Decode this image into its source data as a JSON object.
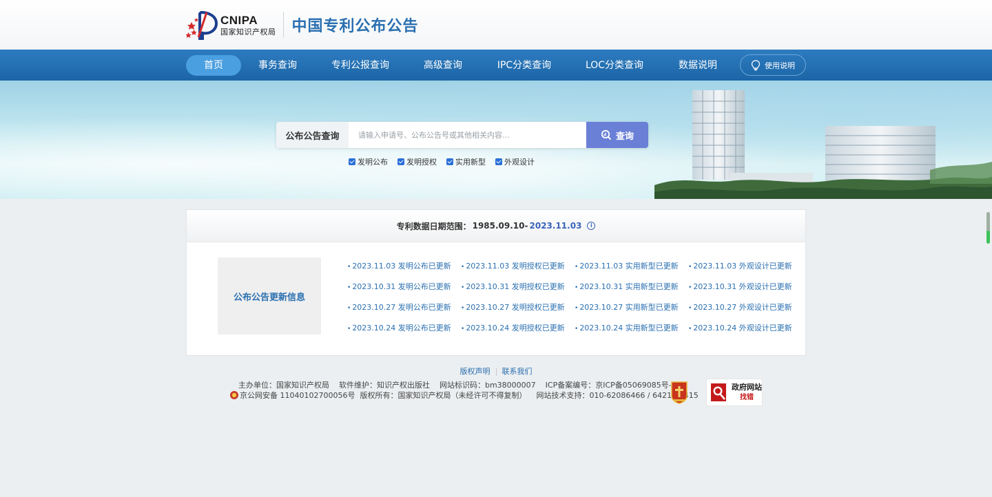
{
  "header": {
    "logo_en": "CNIPA",
    "logo_cn": "国家知识产权局",
    "site_title": "中国专利公布公告"
  },
  "nav": {
    "items": [
      {
        "label": "首页",
        "active": true
      },
      {
        "label": "事务查询"
      },
      {
        "label": "专利公报查询"
      },
      {
        "label": "高级查询"
      },
      {
        "label": "IPC分类查询"
      },
      {
        "label": "LOC分类查询"
      },
      {
        "label": "数据说明"
      }
    ],
    "help_label": "使用说明"
  },
  "search": {
    "label": "公布公告查询",
    "placeholder": "请输入申请号、公布公告号或其他相关内容...",
    "button_label": "查询",
    "filters": [
      "发明公布",
      "发明授权",
      "实用新型",
      "外观设计"
    ]
  },
  "panel": {
    "range_label": "专利数据日期范围：",
    "range_start": "1985.09.10-",
    "range_end": "2023.11.03",
    "info_icon": "info-icon",
    "update_title": "公布公告更新信息",
    "updates": [
      "2023.11.03 发明公布已更新",
      "2023.11.03 发明授权已更新",
      "2023.11.03 实用新型已更新",
      "2023.11.03 外观设计已更新",
      "2023.10.31 发明公布已更新",
      "2023.10.31 发明授权已更新",
      "2023.10.31 实用新型已更新",
      "2023.10.31 外观设计已更新",
      "2023.10.27 发明公布已更新",
      "2023.10.27 发明授权已更新",
      "2023.10.27 实用新型已更新",
      "2023.10.27 外观设计已更新",
      "2023.10.24 发明公布已更新",
      "2023.10.24 发明授权已更新",
      "2023.10.24 实用新型已更新",
      "2023.10.24 外观设计已更新"
    ]
  },
  "footer": {
    "copyright_link": "版权声明",
    "contact_link": "联系我们",
    "line1": "主办单位：国家知识产权局    软件维护：知识产权出版社    网站标识码：bm38000007    ICP备案编号：京ICP备05069085号-14",
    "line2_police": "京公网安备 11040102700056号",
    "line2_rest": "  版权所有：国家知识产权局（未经许可不得复制）    网站技术支持：010-62086466 / 6421 / 6415",
    "gov_badge_line1": "政府网站",
    "gov_badge_line2": "找错"
  },
  "colors": {
    "nav_bg": "#2d7cc0",
    "nav_active": "#4a9fe0",
    "search_button": "#6a7fd6",
    "link_blue": "#2a6fb0",
    "page_bg": "#eceff1"
  }
}
